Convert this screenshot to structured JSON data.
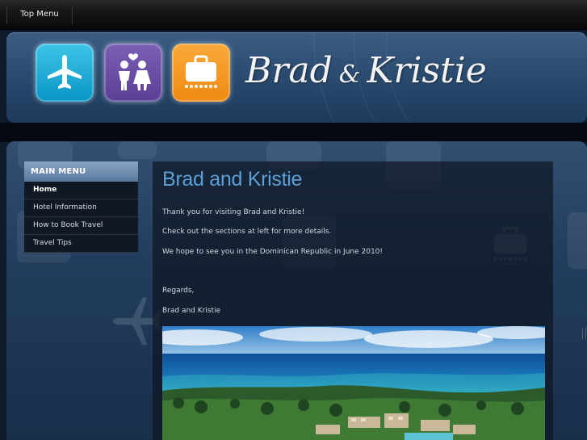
{
  "top_menu": {
    "label": "Top Menu"
  },
  "header": {
    "logo_name_1": "Brad",
    "logo_amp": "&",
    "logo_name_2": "Kristie",
    "tiles": [
      "airplane-icon",
      "couple-icon",
      "luggage-icon"
    ]
  },
  "sidebar": {
    "title": "MAIN MENU",
    "items": [
      {
        "label": "Home",
        "active": true
      },
      {
        "label": "Hotel Information"
      },
      {
        "label": "How to Book Travel"
      },
      {
        "label": "Travel Tips"
      }
    ]
  },
  "main": {
    "title": "Brad and Kristie",
    "paragraphs": [
      "Thank you for visiting Brad and Kristie!",
      "Check out the sections at left for more details.",
      "We hope to see you in the Dominican Republic in June 2010!",
      "Regards,",
      "Brad and Kristie"
    ],
    "photo": "beach-resort-photo"
  },
  "colors": {
    "title_blue": "#5b9fd6",
    "tile_blue": "#0a95c6",
    "tile_purple": "#5a3f96",
    "tile_orange": "#ee8a12"
  }
}
